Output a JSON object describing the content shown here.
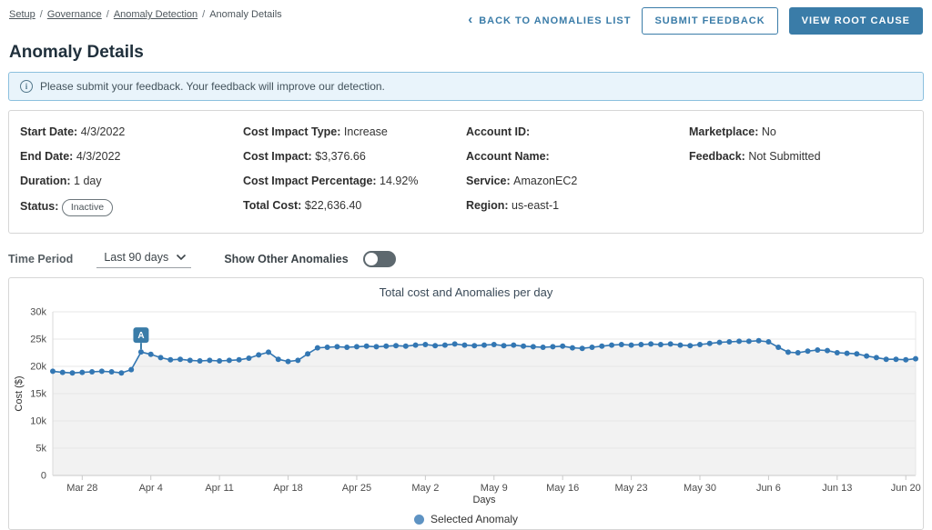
{
  "breadcrumb": {
    "items": [
      {
        "label": "Setup",
        "link": true
      },
      {
        "label": "Governance",
        "link": true
      },
      {
        "label": "Anomaly Detection",
        "link": true
      },
      {
        "label": "Anomaly Details",
        "link": false
      }
    ]
  },
  "header": {
    "title": "Anomaly Details",
    "back_label": "BACK TO ANOMALIES LIST",
    "back_chevron": "‹",
    "submit_feedback_label": "SUBMIT FEEDBACK",
    "view_root_cause_label": "VIEW ROOT CAUSE"
  },
  "banner": {
    "text": "Please submit your feedback. Your feedback will improve our detection.",
    "icon": "info-circle"
  },
  "details": {
    "col1": [
      {
        "label": "Start Date",
        "value": "4/3/2022"
      },
      {
        "label": "End Date",
        "value": "4/3/2022"
      },
      {
        "label": "Duration",
        "value": "1 day"
      },
      {
        "label": "Status",
        "value": "Inactive",
        "pill": true
      }
    ],
    "col2": [
      {
        "label": "Cost Impact Type",
        "value": "Increase"
      },
      {
        "label": "Cost Impact",
        "value": "$3,376.66"
      },
      {
        "label": "Cost Impact Percentage",
        "value": "14.92%"
      },
      {
        "label": "Total Cost",
        "value": "$22,636.40"
      }
    ],
    "col3": [
      {
        "label": "Account ID",
        "value": ""
      },
      {
        "label": "Account Name",
        "value": ""
      },
      {
        "label": "Service",
        "value": "AmazonEC2"
      },
      {
        "label": "Region",
        "value": "us-east-1"
      }
    ],
    "col4": [
      {
        "label": "Marketplace",
        "value": "No"
      },
      {
        "label": "Feedback",
        "value": "Not Submitted"
      }
    ]
  },
  "controls": {
    "time_period_label": "Time Period",
    "time_period_value": "Last 90 days",
    "show_other_label": "Show Other Anomalies",
    "toggle_state": "off"
  },
  "colors": {
    "accent": "#3a7ca8",
    "line": "#3377b3",
    "area_fill": "#f2f2f2",
    "grid": "#e7e7e7",
    "axis": "#c9c9c9",
    "legend_dot": "#5e93c3"
  },
  "chart_data": {
    "type": "line",
    "title": "Total cost and Anomalies per day",
    "xlabel": "Days",
    "ylabel": "Cost ($)",
    "ylim": [
      0,
      30000
    ],
    "yticks": [
      {
        "v": 0,
        "label": "0"
      },
      {
        "v": 5000,
        "label": "5k"
      },
      {
        "v": 10000,
        "label": "10k"
      },
      {
        "v": 15000,
        "label": "15k"
      },
      {
        "v": 20000,
        "label": "20k"
      },
      {
        "v": 25000,
        "label": "25k"
      },
      {
        "v": 30000,
        "label": "30k"
      }
    ],
    "xticks": [
      "Mar 28",
      "Apr 4",
      "Apr 11",
      "Apr 18",
      "Apr 25",
      "May 2",
      "May 9",
      "May 16",
      "May 23",
      "May 30",
      "Jun 6",
      "Jun 13",
      "Jun 20"
    ],
    "legend": [
      {
        "label": "Selected Anomaly"
      }
    ],
    "anomaly": {
      "date": "Apr 3",
      "value": 22636.4,
      "marker": "A"
    },
    "dates": [
      "Mar 25",
      "Mar 26",
      "Mar 27",
      "Mar 28",
      "Mar 29",
      "Mar 30",
      "Mar 31",
      "Apr 1",
      "Apr 2",
      "Apr 3",
      "Apr 4",
      "Apr 5",
      "Apr 6",
      "Apr 7",
      "Apr 8",
      "Apr 9",
      "Apr 10",
      "Apr 11",
      "Apr 12",
      "Apr 13",
      "Apr 14",
      "Apr 15",
      "Apr 16",
      "Apr 17",
      "Apr 18",
      "Apr 19",
      "Apr 20",
      "Apr 21",
      "Apr 22",
      "Apr 23",
      "Apr 24",
      "Apr 25",
      "Apr 26",
      "Apr 27",
      "Apr 28",
      "Apr 29",
      "Apr 30",
      "May 1",
      "May 2",
      "May 3",
      "May 4",
      "May 5",
      "May 6",
      "May 7",
      "May 8",
      "May 9",
      "May 10",
      "May 11",
      "May 12",
      "May 13",
      "May 14",
      "May 15",
      "May 16",
      "May 17",
      "May 18",
      "May 19",
      "May 20",
      "May 21",
      "May 22",
      "May 23",
      "May 24",
      "May 25",
      "May 26",
      "May 27",
      "May 28",
      "May 29",
      "May 30",
      "May 31",
      "Jun 1",
      "Jun 2",
      "Jun 3",
      "Jun 4",
      "Jun 5",
      "Jun 6",
      "Jun 7",
      "Jun 8",
      "Jun 9",
      "Jun 10",
      "Jun 11",
      "Jun 12",
      "Jun 13",
      "Jun 14",
      "Jun 15",
      "Jun 16",
      "Jun 17",
      "Jun 18",
      "Jun 19",
      "Jun 20",
      "Jun 21"
    ],
    "values": [
      19100,
      18900,
      18800,
      18900,
      19000,
      19100,
      19000,
      18800,
      19400,
      22636,
      22200,
      21600,
      21200,
      21300,
      21100,
      21000,
      21100,
      21000,
      21100,
      21200,
      21500,
      22100,
      22600,
      21300,
      20900,
      21100,
      22300,
      23400,
      23500,
      23600,
      23500,
      23600,
      23700,
      23600,
      23700,
      23800,
      23700,
      23900,
      24000,
      23800,
      23900,
      24100,
      23900,
      23800,
      23900,
      24000,
      23800,
      23900,
      23700,
      23600,
      23500,
      23600,
      23700,
      23400,
      23300,
      23500,
      23700,
      23900,
      24000,
      23900,
      24000,
      24100,
      24000,
      24100,
      23900,
      23800,
      24000,
      24200,
      24400,
      24500,
      24600,
      24600,
      24700,
      24500,
      23500,
      22600,
      22500,
      22800,
      23000,
      22900,
      22500,
      22400,
      22300,
      21900,
      21600,
      21300,
      21300,
      21200,
      21400
    ]
  }
}
